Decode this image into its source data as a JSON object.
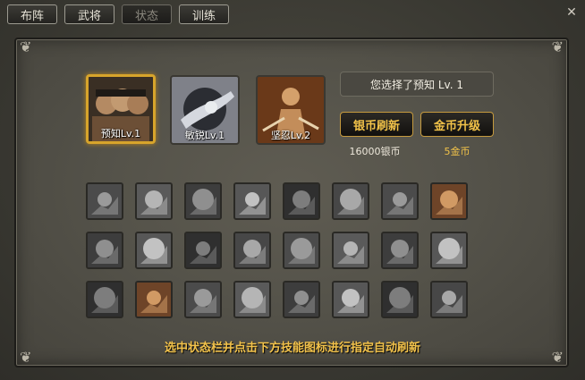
{
  "tabs": [
    {
      "label": "布阵",
      "active": false
    },
    {
      "label": "武将",
      "active": false
    },
    {
      "label": "状态",
      "active": true
    },
    {
      "label": "训练",
      "active": false
    }
  ],
  "status_slots": [
    {
      "label": "预知Lv.1",
      "icon": "three-generals-icon",
      "selected": true
    },
    {
      "label": "敏锐Lv.1",
      "icon": "sharp-swirl-icon",
      "selected": false
    },
    {
      "label": "坚忍Lv.2",
      "icon": "enduring-warrior-icon",
      "selected": false
    }
  ],
  "selection_text": "您选择了预知 Lv. 1",
  "buttons": {
    "silver_refresh": "银币刷新",
    "gold_upgrade": "金币升级"
  },
  "costs": {
    "silver": "16000银币",
    "gold": "5金币"
  },
  "colors": {
    "accent_gold": "#f1c249",
    "selected_border": "#d7a42b",
    "panel_bg": "#55534a"
  },
  "skill_icons": [
    [
      "target-icon",
      "pagoda-icon",
      "horse-rider-icon",
      "sword-slash-icon",
      "cloaked-figure-icon",
      "ripple-icon",
      "soldier-icon",
      "warrior-portrait-icon"
    ],
    [
      "fist-burst-icon",
      "knight-icon",
      "charging-horse-icon",
      "mounted-archer-icon",
      "lightning-icon",
      "shield-icon",
      "armored-general-icon",
      "sage-face-icon"
    ],
    [
      "broken-heart-icon",
      "three-generals-icon",
      "compass-shield-icon",
      "crescent-icon",
      "general-face-icon",
      "vortex-icon",
      "army-silhouette-icon",
      "helmet-warrior-icon"
    ]
  ],
  "hint": "选中状态栏并点击下方技能图标进行指定自动刷新"
}
